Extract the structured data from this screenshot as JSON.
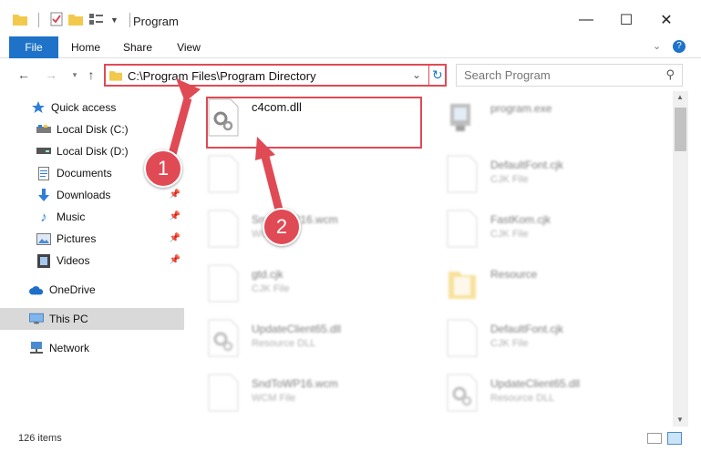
{
  "window": {
    "title": "Program",
    "minimize_glyph": "—",
    "maximize_glyph": "☐",
    "close_glyph": "✕"
  },
  "ribbon": {
    "tabs": [
      {
        "label": "File"
      },
      {
        "label": "Home"
      },
      {
        "label": "Share"
      },
      {
        "label": "View"
      }
    ]
  },
  "navigation": {
    "address_path": "C:\\Program Files\\Program Directory",
    "search_placeholder": "Search Program"
  },
  "sidebar": {
    "items": [
      {
        "label": "Quick access",
        "icon": "star-icon"
      },
      {
        "label": "Local Disk (C:)",
        "icon": "drive-icon"
      },
      {
        "label": "Local Disk (D:)",
        "icon": "drive-icon"
      },
      {
        "label": "Documents",
        "icon": "document-icon"
      },
      {
        "label": "Downloads",
        "icon": "download-icon"
      },
      {
        "label": "Music",
        "icon": "music-icon"
      },
      {
        "label": "Pictures",
        "icon": "picture-icon"
      },
      {
        "label": "Videos",
        "icon": "video-icon"
      },
      {
        "label": "OneDrive",
        "icon": "cloud-icon"
      },
      {
        "label": "This PC",
        "icon": "computer-icon"
      },
      {
        "label": "Network",
        "icon": "network-icon"
      }
    ]
  },
  "files": [
    {
      "name": "c4com.dll",
      "type": ""
    },
    {
      "name": "program.exe",
      "type": ""
    },
    {
      "name": "",
      "type": ""
    },
    {
      "name": "DefaultFont.cjk",
      "type": "CJK File"
    },
    {
      "name": "SndToWP16.wcm",
      "type": "WCM File"
    },
    {
      "name": "FastKom.cjk",
      "type": "CJK File"
    },
    {
      "name": "gtd.cjk",
      "type": "CJK File"
    },
    {
      "name": "Resource",
      "type": ""
    },
    {
      "name": "UpdateClient65.dll",
      "type": "Resource DLL"
    },
    {
      "name": "DefaultFont.cjk",
      "type": "CJK File"
    },
    {
      "name": "SndToWP16.wcm",
      "type": "WCM File"
    },
    {
      "name": "UpdateClient65.dll",
      "type": "Resource DLL"
    }
  ],
  "status": {
    "item_count": "126 items"
  },
  "annotations": {
    "step1": "1",
    "step2": "2"
  },
  "colors": {
    "accent": "#1e73c8",
    "annotation_red": "#e04a55",
    "folder_yellow": "#f2c94c"
  }
}
